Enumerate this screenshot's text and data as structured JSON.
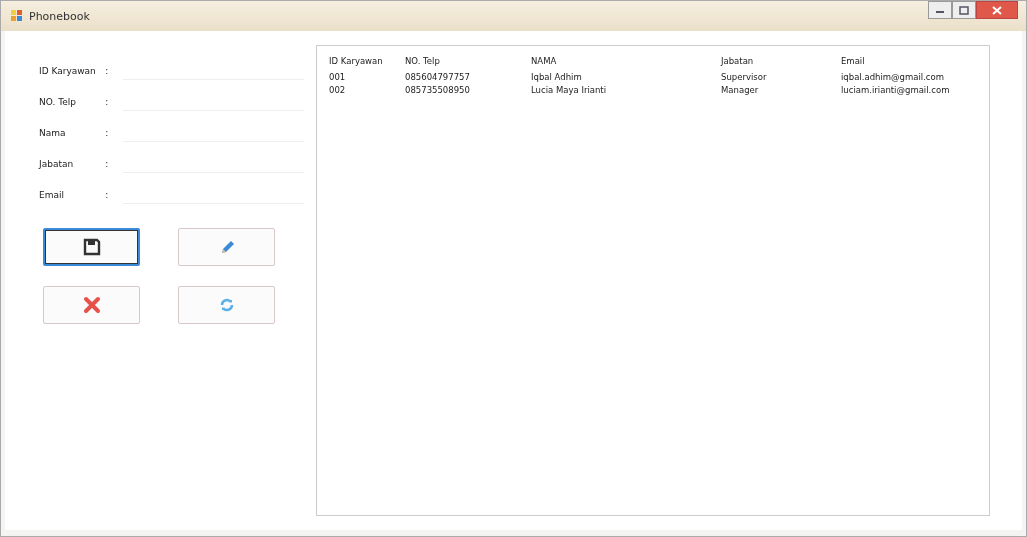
{
  "window": {
    "title": "Phonebook"
  },
  "form": {
    "fields": [
      {
        "label": "ID Karyawan",
        "colon": ":"
      },
      {
        "label": "NO. Telp",
        "colon": ":"
      },
      {
        "label": "Nama",
        "colon": ":"
      },
      {
        "label": "Jabatan",
        "colon": ":"
      },
      {
        "label": "Email",
        "colon": ":"
      }
    ]
  },
  "buttons": [
    {
      "kind": "save",
      "focused": true
    },
    {
      "kind": "edit",
      "focused": false
    },
    {
      "kind": "delete",
      "focused": false
    },
    {
      "kind": "refresh",
      "focused": false
    }
  ],
  "table": {
    "columns": [
      "ID Karyawan",
      "NO. Telp",
      "NAMA",
      "Jabatan",
      "Email"
    ],
    "rows": [
      [
        "001",
        "085604797757",
        "Iqbal Adhim",
        "Supervisor",
        "iqbal.adhim@gmail.com"
      ],
      [
        "002",
        "085735508950",
        "Lucia Maya Irianti",
        "Manager",
        "luciam.irianti@gmail.com"
      ]
    ]
  }
}
